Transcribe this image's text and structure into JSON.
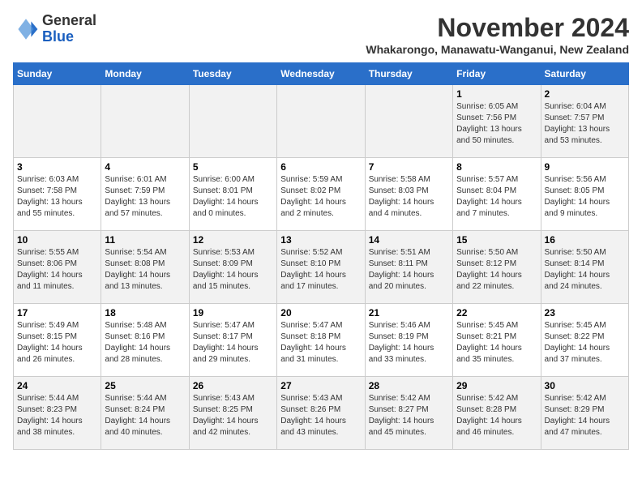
{
  "logo": {
    "general": "General",
    "blue": "Blue"
  },
  "title": "November 2024",
  "location": "Whakarongo, Manawatu-Wanganui, New Zealand",
  "days_of_week": [
    "Sunday",
    "Monday",
    "Tuesday",
    "Wednesday",
    "Thursday",
    "Friday",
    "Saturday"
  ],
  "weeks": [
    [
      {
        "day": "",
        "info": ""
      },
      {
        "day": "",
        "info": ""
      },
      {
        "day": "",
        "info": ""
      },
      {
        "day": "",
        "info": ""
      },
      {
        "day": "",
        "info": ""
      },
      {
        "day": "1",
        "info": "Sunrise: 6:05 AM\nSunset: 7:56 PM\nDaylight: 13 hours and 50 minutes."
      },
      {
        "day": "2",
        "info": "Sunrise: 6:04 AM\nSunset: 7:57 PM\nDaylight: 13 hours and 53 minutes."
      }
    ],
    [
      {
        "day": "3",
        "info": "Sunrise: 6:03 AM\nSunset: 7:58 PM\nDaylight: 13 hours and 55 minutes."
      },
      {
        "day": "4",
        "info": "Sunrise: 6:01 AM\nSunset: 7:59 PM\nDaylight: 13 hours and 57 minutes."
      },
      {
        "day": "5",
        "info": "Sunrise: 6:00 AM\nSunset: 8:01 PM\nDaylight: 14 hours and 0 minutes."
      },
      {
        "day": "6",
        "info": "Sunrise: 5:59 AM\nSunset: 8:02 PM\nDaylight: 14 hours and 2 minutes."
      },
      {
        "day": "7",
        "info": "Sunrise: 5:58 AM\nSunset: 8:03 PM\nDaylight: 14 hours and 4 minutes."
      },
      {
        "day": "8",
        "info": "Sunrise: 5:57 AM\nSunset: 8:04 PM\nDaylight: 14 hours and 7 minutes."
      },
      {
        "day": "9",
        "info": "Sunrise: 5:56 AM\nSunset: 8:05 PM\nDaylight: 14 hours and 9 minutes."
      }
    ],
    [
      {
        "day": "10",
        "info": "Sunrise: 5:55 AM\nSunset: 8:06 PM\nDaylight: 14 hours and 11 minutes."
      },
      {
        "day": "11",
        "info": "Sunrise: 5:54 AM\nSunset: 8:08 PM\nDaylight: 14 hours and 13 minutes."
      },
      {
        "day": "12",
        "info": "Sunrise: 5:53 AM\nSunset: 8:09 PM\nDaylight: 14 hours and 15 minutes."
      },
      {
        "day": "13",
        "info": "Sunrise: 5:52 AM\nSunset: 8:10 PM\nDaylight: 14 hours and 17 minutes."
      },
      {
        "day": "14",
        "info": "Sunrise: 5:51 AM\nSunset: 8:11 PM\nDaylight: 14 hours and 20 minutes."
      },
      {
        "day": "15",
        "info": "Sunrise: 5:50 AM\nSunset: 8:12 PM\nDaylight: 14 hours and 22 minutes."
      },
      {
        "day": "16",
        "info": "Sunrise: 5:50 AM\nSunset: 8:14 PM\nDaylight: 14 hours and 24 minutes."
      }
    ],
    [
      {
        "day": "17",
        "info": "Sunrise: 5:49 AM\nSunset: 8:15 PM\nDaylight: 14 hours and 26 minutes."
      },
      {
        "day": "18",
        "info": "Sunrise: 5:48 AM\nSunset: 8:16 PM\nDaylight: 14 hours and 28 minutes."
      },
      {
        "day": "19",
        "info": "Sunrise: 5:47 AM\nSunset: 8:17 PM\nDaylight: 14 hours and 29 minutes."
      },
      {
        "day": "20",
        "info": "Sunrise: 5:47 AM\nSunset: 8:18 PM\nDaylight: 14 hours and 31 minutes."
      },
      {
        "day": "21",
        "info": "Sunrise: 5:46 AM\nSunset: 8:19 PM\nDaylight: 14 hours and 33 minutes."
      },
      {
        "day": "22",
        "info": "Sunrise: 5:45 AM\nSunset: 8:21 PM\nDaylight: 14 hours and 35 minutes."
      },
      {
        "day": "23",
        "info": "Sunrise: 5:45 AM\nSunset: 8:22 PM\nDaylight: 14 hours and 37 minutes."
      }
    ],
    [
      {
        "day": "24",
        "info": "Sunrise: 5:44 AM\nSunset: 8:23 PM\nDaylight: 14 hours and 38 minutes."
      },
      {
        "day": "25",
        "info": "Sunrise: 5:44 AM\nSunset: 8:24 PM\nDaylight: 14 hours and 40 minutes."
      },
      {
        "day": "26",
        "info": "Sunrise: 5:43 AM\nSunset: 8:25 PM\nDaylight: 14 hours and 42 minutes."
      },
      {
        "day": "27",
        "info": "Sunrise: 5:43 AM\nSunset: 8:26 PM\nDaylight: 14 hours and 43 minutes."
      },
      {
        "day": "28",
        "info": "Sunrise: 5:42 AM\nSunset: 8:27 PM\nDaylight: 14 hours and 45 minutes."
      },
      {
        "day": "29",
        "info": "Sunrise: 5:42 AM\nSunset: 8:28 PM\nDaylight: 14 hours and 46 minutes."
      },
      {
        "day": "30",
        "info": "Sunrise: 5:42 AM\nSunset: 8:29 PM\nDaylight: 14 hours and 47 minutes."
      }
    ]
  ]
}
